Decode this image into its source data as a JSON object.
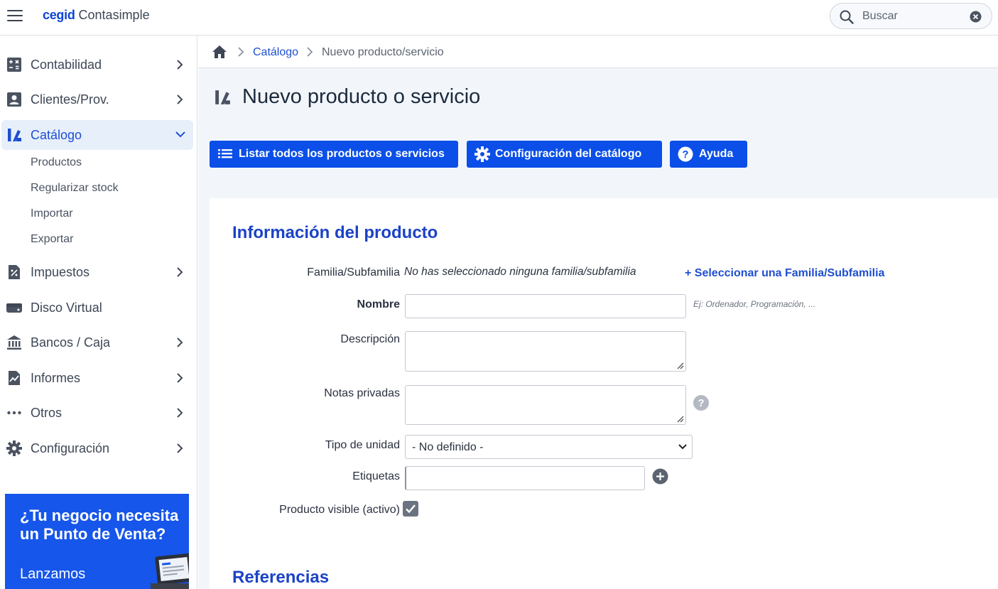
{
  "header": {
    "brand_company": "cegid",
    "brand_app": "Contasimple",
    "search_placeholder": "Buscar"
  },
  "sidebar": {
    "items": [
      {
        "label": "Contabilidad",
        "icon": "calculator-icon"
      },
      {
        "label": "Clientes/Prov.",
        "icon": "contact-card-icon"
      },
      {
        "label": "Catálogo",
        "icon": "catalog-icon",
        "active": true
      },
      {
        "label": "Impuestos",
        "icon": "tax-document-icon"
      },
      {
        "label": "Disco Virtual",
        "icon": "hard-drive-icon"
      },
      {
        "label": "Bancos / Caja",
        "icon": "bank-icon"
      },
      {
        "label": "Informes",
        "icon": "report-chart-icon"
      },
      {
        "label": "Otros",
        "icon": "more-dots-icon"
      },
      {
        "label": "Configuración",
        "icon": "gear-icon"
      }
    ],
    "catalog_subitems": [
      "Productos",
      "Regularizar stock",
      "Importar",
      "Exportar"
    ],
    "promo": {
      "title": "¿Tu negocio necesita un Punto de Venta?",
      "subtitle": "Lanzamos"
    }
  },
  "breadcrumb": {
    "link": "Catálogo",
    "current": "Nuevo producto/servicio"
  },
  "page": {
    "title": "Nuevo producto o servicio",
    "buttons": {
      "list_all": "Listar todos los productos o servicios",
      "catalog_config": "Configuración del catálogo",
      "help": "Ayuda"
    }
  },
  "form": {
    "section_title": "Información del producto",
    "family_label": "Familia/Subfamilia",
    "family_value": "No has seleccionado ninguna familia/subfamilia",
    "select_family_link": "+ Seleccionar una Familia/Subfamilia",
    "name_label": "Nombre",
    "name_value": "",
    "name_hint": "Ej: Ordenador, Programación, ...",
    "description_label": "Descripción",
    "description_value": "",
    "private_notes_label": "Notas privadas",
    "private_notes_value": "",
    "unit_type_label": "Tipo de unidad",
    "unit_type_value": "- No definido -",
    "tags_label": "Etiquetas",
    "tags_value": "",
    "visible_label": "Producto visible (activo)",
    "visible_checked": true,
    "next_section_title": "Referencias"
  },
  "colors": {
    "accent": "#0b4fe8",
    "link": "#1f4fcf",
    "section_title": "#1b43c6",
    "promo_bg": "#1656ea",
    "active_nav_bg": "#e7effb"
  }
}
